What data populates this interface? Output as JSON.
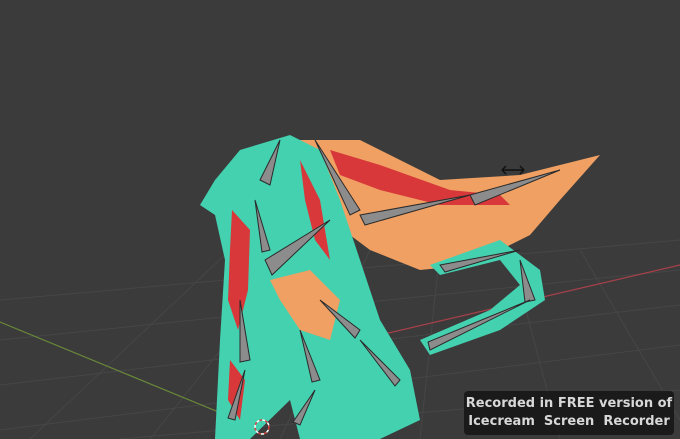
{
  "viewport": {
    "name": "3D Viewport",
    "background_color": "#3b3b3b",
    "x_axis_color": "#a8404a",
    "y_axis_color": "#6a8a3a"
  },
  "model": {
    "name": "dragon-armature",
    "body_color": "#43d1b0",
    "wing_color": "#f0a062",
    "stripe_color": "#d8383a",
    "bone_color": "#8a8a8a"
  },
  "watermark": {
    "line1": "Recorded in FREE version of",
    "line2": "Icecream  Screen  Recorder"
  }
}
